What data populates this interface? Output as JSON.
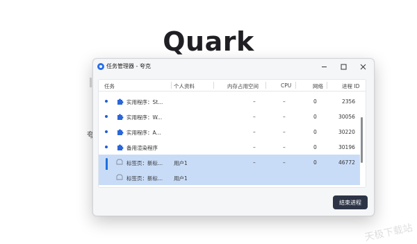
{
  "background": {
    "logo_text": "Quark",
    "side_char": "夸"
  },
  "window": {
    "title": "任务管理器 - 夸克",
    "controls": {
      "minimize": "minimize",
      "maximize": "maximize",
      "close": "close"
    }
  },
  "table": {
    "columns": [
      "任务",
      "个人资料",
      "内存占用空间",
      "CPU",
      "网络",
      "进程 ID"
    ],
    "rows": [
      {
        "task": "实用程序：St...",
        "profile": "",
        "memory": "–",
        "cpu": "–",
        "network": "0",
        "pid": "2356",
        "icon": "puzzle-icon",
        "selected": false
      },
      {
        "task": "实用程序：W...",
        "profile": "",
        "memory": "–",
        "cpu": "–",
        "network": "0",
        "pid": "30056",
        "icon": "puzzle-icon",
        "selected": false
      },
      {
        "task": "实用程序：A...",
        "profile": "",
        "memory": "–",
        "cpu": "–",
        "network": "0",
        "pid": "30220",
        "icon": "puzzle-icon",
        "selected": false
      },
      {
        "task": "备用渲染程序",
        "profile": "",
        "memory": "–",
        "cpu": "–",
        "network": "0",
        "pid": "30196",
        "icon": "puzzle-icon",
        "selected": false
      },
      {
        "task": "标签页：新标...",
        "profile": "用户1",
        "memory": "–",
        "cpu": "–",
        "network": "0",
        "pid": "46772",
        "icon": "tab-icon",
        "selected": true
      },
      {
        "task": "标签页：新标...",
        "profile": "用户1",
        "memory": "",
        "cpu": "",
        "network": "",
        "pid": "",
        "icon": "tab-icon",
        "selected": true
      }
    ]
  },
  "end_button_label": "结束进程",
  "colors": {
    "accent": "#1f6fe0",
    "selected_row": "#c9dcf7",
    "end_button": "#2d3446"
  }
}
